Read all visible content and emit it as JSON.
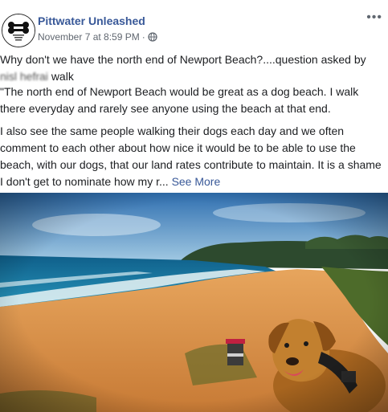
{
  "post": {
    "page_name": "Pittwater Unleashed",
    "timestamp": "November 7 at 8:59 PM",
    "separator": "·",
    "more_label": "•••",
    "line1": "Why don't we have the north end of Newport Beach?....question asked by",
    "line2_blurred": "nisl  hefrai",
    "line2_end": "walk",
    "paragraph1": "\"The north end of Newport Beach would be great as a dog beach. I walk there everyday and rarely see anyone using the beach at that end.",
    "paragraph2": "I also see the same people walking their dogs each day and we often comment to each other about how nice it would be to be able to use the beach, with our dogs, that our land rates contribute to maintain. It is a shame I don't get to nominate how my r...",
    "see_more": "See More"
  },
  "icons": {
    "avatar": "bone-logo-icon",
    "privacy": "globe-icon",
    "more": "more-options-icon"
  },
  "colors": {
    "link": "#385898",
    "text": "#1c1e21",
    "meta": "#606770",
    "sand": "#d9924a",
    "sea": "#1f7ea8",
    "sky": "#5aa8d8",
    "dog": "#c07a2c"
  }
}
